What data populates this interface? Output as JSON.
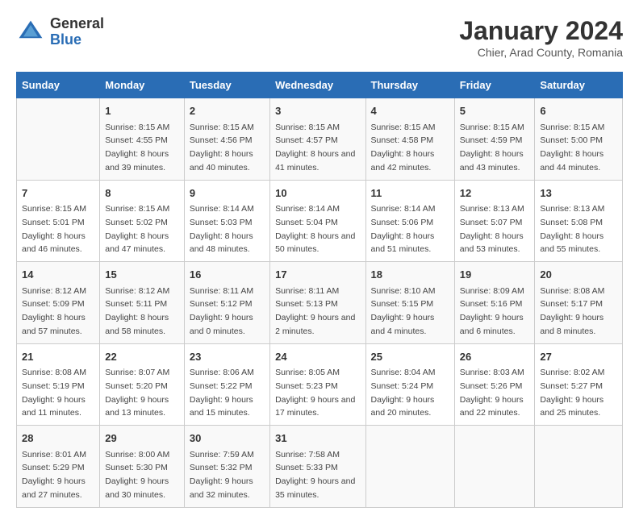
{
  "logo": {
    "general": "General",
    "blue": "Blue"
  },
  "title": "January 2024",
  "subtitle": "Chier, Arad County, Romania",
  "days_of_week": [
    "Sunday",
    "Monday",
    "Tuesday",
    "Wednesday",
    "Thursday",
    "Friday",
    "Saturday"
  ],
  "weeks": [
    [
      {
        "day": "",
        "sunrise": "",
        "sunset": "",
        "daylight": ""
      },
      {
        "day": "1",
        "sunrise": "Sunrise: 8:15 AM",
        "sunset": "Sunset: 4:55 PM",
        "daylight": "Daylight: 8 hours and 39 minutes."
      },
      {
        "day": "2",
        "sunrise": "Sunrise: 8:15 AM",
        "sunset": "Sunset: 4:56 PM",
        "daylight": "Daylight: 8 hours and 40 minutes."
      },
      {
        "day": "3",
        "sunrise": "Sunrise: 8:15 AM",
        "sunset": "Sunset: 4:57 PM",
        "daylight": "Daylight: 8 hours and 41 minutes."
      },
      {
        "day": "4",
        "sunrise": "Sunrise: 8:15 AM",
        "sunset": "Sunset: 4:58 PM",
        "daylight": "Daylight: 8 hours and 42 minutes."
      },
      {
        "day": "5",
        "sunrise": "Sunrise: 8:15 AM",
        "sunset": "Sunset: 4:59 PM",
        "daylight": "Daylight: 8 hours and 43 minutes."
      },
      {
        "day": "6",
        "sunrise": "Sunrise: 8:15 AM",
        "sunset": "Sunset: 5:00 PM",
        "daylight": "Daylight: 8 hours and 44 minutes."
      }
    ],
    [
      {
        "day": "7",
        "sunrise": "Sunrise: 8:15 AM",
        "sunset": "Sunset: 5:01 PM",
        "daylight": "Daylight: 8 hours and 46 minutes."
      },
      {
        "day": "8",
        "sunrise": "Sunrise: 8:15 AM",
        "sunset": "Sunset: 5:02 PM",
        "daylight": "Daylight: 8 hours and 47 minutes."
      },
      {
        "day": "9",
        "sunrise": "Sunrise: 8:14 AM",
        "sunset": "Sunset: 5:03 PM",
        "daylight": "Daylight: 8 hours and 48 minutes."
      },
      {
        "day": "10",
        "sunrise": "Sunrise: 8:14 AM",
        "sunset": "Sunset: 5:04 PM",
        "daylight": "Daylight: 8 hours and 50 minutes."
      },
      {
        "day": "11",
        "sunrise": "Sunrise: 8:14 AM",
        "sunset": "Sunset: 5:06 PM",
        "daylight": "Daylight: 8 hours and 51 minutes."
      },
      {
        "day": "12",
        "sunrise": "Sunrise: 8:13 AM",
        "sunset": "Sunset: 5:07 PM",
        "daylight": "Daylight: 8 hours and 53 minutes."
      },
      {
        "day": "13",
        "sunrise": "Sunrise: 8:13 AM",
        "sunset": "Sunset: 5:08 PM",
        "daylight": "Daylight: 8 hours and 55 minutes."
      }
    ],
    [
      {
        "day": "14",
        "sunrise": "Sunrise: 8:12 AM",
        "sunset": "Sunset: 5:09 PM",
        "daylight": "Daylight: 8 hours and 57 minutes."
      },
      {
        "day": "15",
        "sunrise": "Sunrise: 8:12 AM",
        "sunset": "Sunset: 5:11 PM",
        "daylight": "Daylight: 8 hours and 58 minutes."
      },
      {
        "day": "16",
        "sunrise": "Sunrise: 8:11 AM",
        "sunset": "Sunset: 5:12 PM",
        "daylight": "Daylight: 9 hours and 0 minutes."
      },
      {
        "day": "17",
        "sunrise": "Sunrise: 8:11 AM",
        "sunset": "Sunset: 5:13 PM",
        "daylight": "Daylight: 9 hours and 2 minutes."
      },
      {
        "day": "18",
        "sunrise": "Sunrise: 8:10 AM",
        "sunset": "Sunset: 5:15 PM",
        "daylight": "Daylight: 9 hours and 4 minutes."
      },
      {
        "day": "19",
        "sunrise": "Sunrise: 8:09 AM",
        "sunset": "Sunset: 5:16 PM",
        "daylight": "Daylight: 9 hours and 6 minutes."
      },
      {
        "day": "20",
        "sunrise": "Sunrise: 8:08 AM",
        "sunset": "Sunset: 5:17 PM",
        "daylight": "Daylight: 9 hours and 8 minutes."
      }
    ],
    [
      {
        "day": "21",
        "sunrise": "Sunrise: 8:08 AM",
        "sunset": "Sunset: 5:19 PM",
        "daylight": "Daylight: 9 hours and 11 minutes."
      },
      {
        "day": "22",
        "sunrise": "Sunrise: 8:07 AM",
        "sunset": "Sunset: 5:20 PM",
        "daylight": "Daylight: 9 hours and 13 minutes."
      },
      {
        "day": "23",
        "sunrise": "Sunrise: 8:06 AM",
        "sunset": "Sunset: 5:22 PM",
        "daylight": "Daylight: 9 hours and 15 minutes."
      },
      {
        "day": "24",
        "sunrise": "Sunrise: 8:05 AM",
        "sunset": "Sunset: 5:23 PM",
        "daylight": "Daylight: 9 hours and 17 minutes."
      },
      {
        "day": "25",
        "sunrise": "Sunrise: 8:04 AM",
        "sunset": "Sunset: 5:24 PM",
        "daylight": "Daylight: 9 hours and 20 minutes."
      },
      {
        "day": "26",
        "sunrise": "Sunrise: 8:03 AM",
        "sunset": "Sunset: 5:26 PM",
        "daylight": "Daylight: 9 hours and 22 minutes."
      },
      {
        "day": "27",
        "sunrise": "Sunrise: 8:02 AM",
        "sunset": "Sunset: 5:27 PM",
        "daylight": "Daylight: 9 hours and 25 minutes."
      }
    ],
    [
      {
        "day": "28",
        "sunrise": "Sunrise: 8:01 AM",
        "sunset": "Sunset: 5:29 PM",
        "daylight": "Daylight: 9 hours and 27 minutes."
      },
      {
        "day": "29",
        "sunrise": "Sunrise: 8:00 AM",
        "sunset": "Sunset: 5:30 PM",
        "daylight": "Daylight: 9 hours and 30 minutes."
      },
      {
        "day": "30",
        "sunrise": "Sunrise: 7:59 AM",
        "sunset": "Sunset: 5:32 PM",
        "daylight": "Daylight: 9 hours and 32 minutes."
      },
      {
        "day": "31",
        "sunrise": "Sunrise: 7:58 AM",
        "sunset": "Sunset: 5:33 PM",
        "daylight": "Daylight: 9 hours and 35 minutes."
      },
      {
        "day": "",
        "sunrise": "",
        "sunset": "",
        "daylight": ""
      },
      {
        "day": "",
        "sunrise": "",
        "sunset": "",
        "daylight": ""
      },
      {
        "day": "",
        "sunrise": "",
        "sunset": "",
        "daylight": ""
      }
    ]
  ]
}
